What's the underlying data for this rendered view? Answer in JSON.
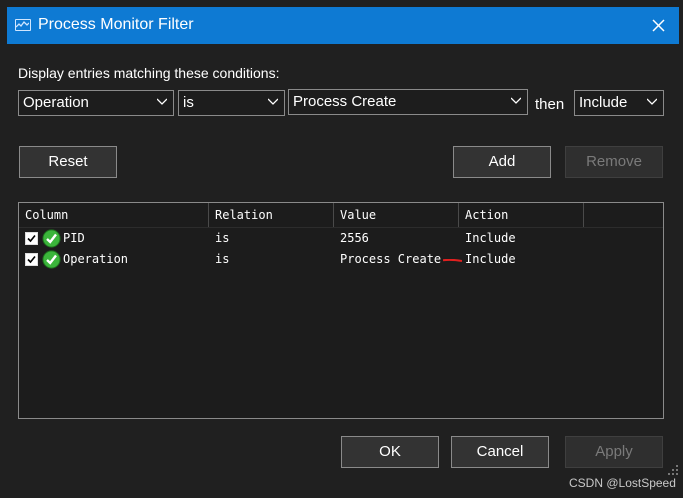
{
  "window": {
    "title": "Process Monitor Filter",
    "accent_color": "#0e7ad3",
    "icon": "process-monitor-icon",
    "close_icon": "close-icon"
  },
  "conditions": {
    "label": "Display entries matching these conditions:",
    "column_value": "Operation",
    "relation_value": "is",
    "value_value": "Process Create",
    "then_label": "then",
    "action_value": "Include"
  },
  "buttons": {
    "reset": "Reset",
    "add": "Add",
    "remove": "Remove",
    "ok": "OK",
    "cancel": "Cancel",
    "apply": "Apply"
  },
  "list": {
    "headers": [
      "Column",
      "Relation",
      "Value",
      "Action"
    ],
    "rows": [
      {
        "checked": true,
        "column": "PID",
        "relation": "is",
        "value": "2556",
        "action": "Include"
      },
      {
        "checked": true,
        "column": "Operation",
        "relation": "is",
        "value": "Process Create",
        "action": "Include"
      }
    ],
    "annotation_color": "#e0201f"
  },
  "watermark": "CSDN @LostSpeed"
}
